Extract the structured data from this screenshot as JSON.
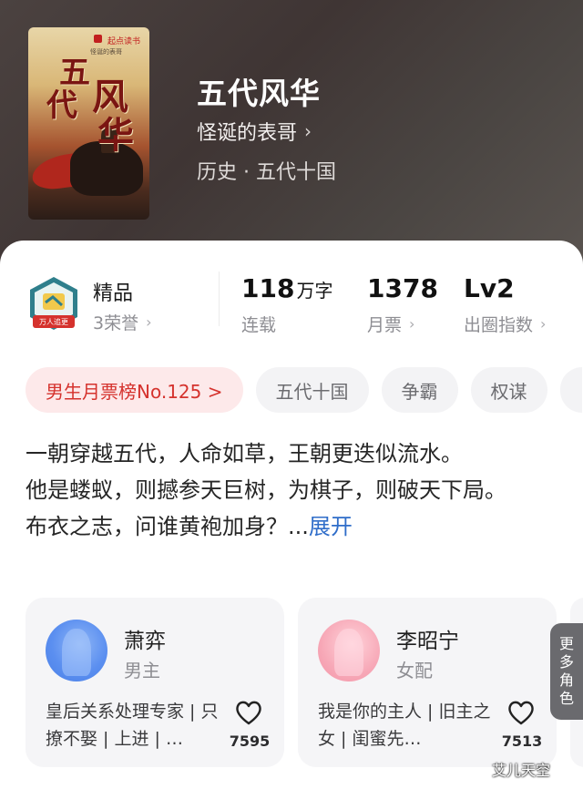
{
  "book": {
    "title": "五代风华",
    "author": "怪诞的表哥",
    "genre": "历史 · 五代十国",
    "cover": {
      "title_chars": [
        "五",
        "代",
        "风",
        "华"
      ],
      "brand": "起点读书",
      "author_small": "怪诞的表哥"
    }
  },
  "stats": {
    "quality": {
      "label": "精品",
      "sub": "3荣誉",
      "badge_text": "万人追更"
    },
    "words": {
      "value": "118",
      "unit": "万字",
      "sub": "连载"
    },
    "monthly_votes": {
      "value": "1378",
      "sub": "月票"
    },
    "breakout": {
      "value": "Lv2",
      "sub": "出圈指数"
    }
  },
  "tags": [
    "男生月票榜No.125 >",
    "五代十国",
    "争霸",
    "权谋"
  ],
  "description": {
    "line1": "一朝穿越五代，人命如草，王朝更迭似流水。",
    "line2": "他是蝼蚁，则撼参天巨树，为棋子，则破天下局。",
    "line3": "布衣之志，问谁黄袍加身？...",
    "expand": "展开"
  },
  "characters": [
    {
      "name": "萧弈",
      "role": "男主",
      "desc": "皇后关系处理专家 | 只撩不娶 | 上进 | …",
      "likes": "7595"
    },
    {
      "name": "李昭宁",
      "role": "女配",
      "desc": "我是你的主人 | 旧主之女 | 闺蜜先…",
      "likes": "7513"
    }
  ],
  "more_roles": [
    "更",
    "多",
    "角",
    "色"
  ],
  "watermark": "艾儿天空",
  "colors": {
    "accent_red": "#d5322d",
    "link_blue": "#2f6dc9",
    "hero_bg": "#443a38"
  }
}
